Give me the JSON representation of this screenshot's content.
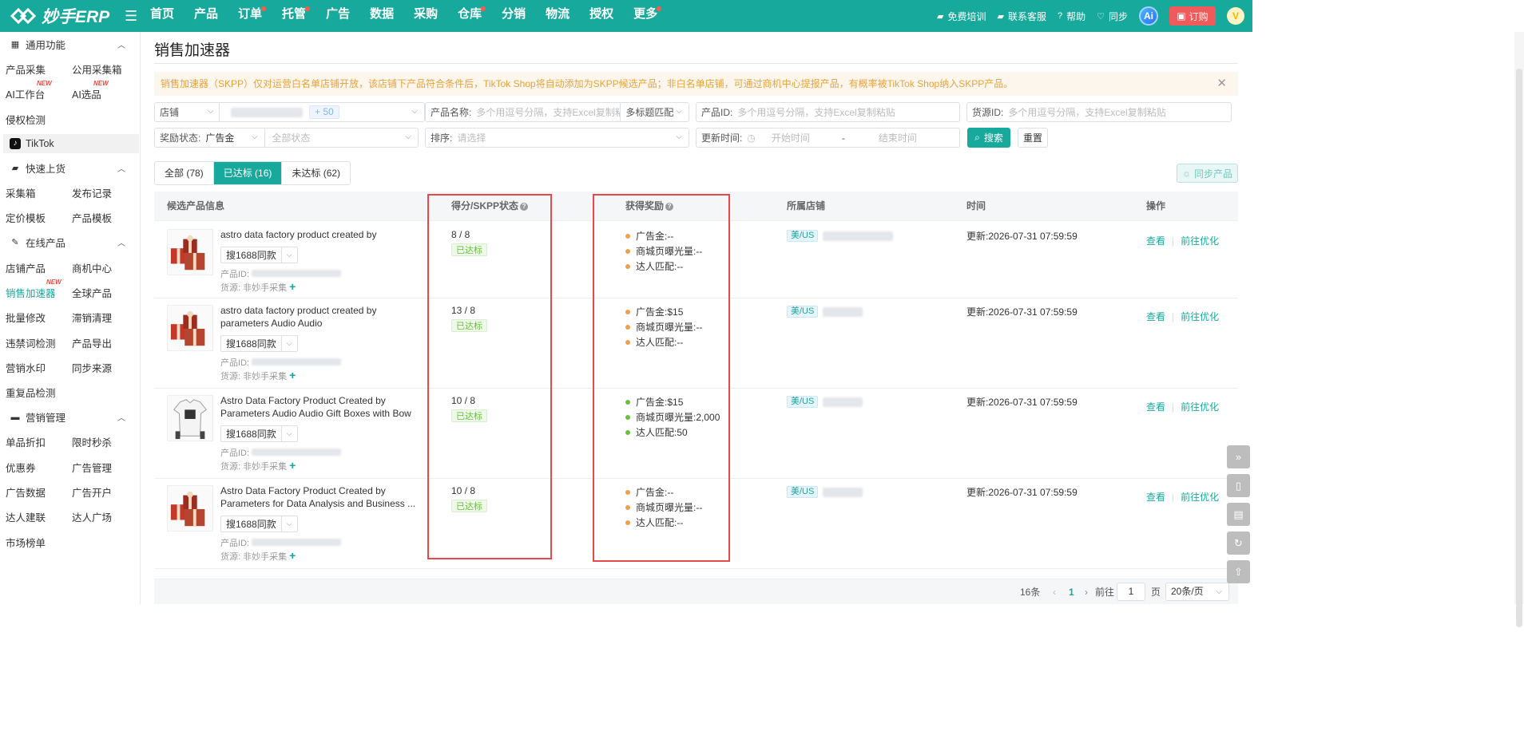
{
  "brand": {
    "name": "妙手ERP"
  },
  "nav": [
    {
      "label": "首页",
      "dot": false
    },
    {
      "label": "产品",
      "dot": false
    },
    {
      "label": "订单",
      "dot": true
    },
    {
      "label": "托管",
      "dot": true
    },
    {
      "label": "广告",
      "dot": false
    },
    {
      "label": "数据",
      "dot": false
    },
    {
      "label": "采购",
      "dot": false
    },
    {
      "label": "仓库",
      "dot": true
    },
    {
      "label": "分销",
      "dot": false
    },
    {
      "label": "物流",
      "dot": false
    },
    {
      "label": "授权",
      "dot": false
    },
    {
      "label": "更多",
      "dot": true
    }
  ],
  "topright": {
    "training": "免费培训",
    "service": "联系客服",
    "help": "帮助",
    "sync": "同步",
    "ai": "Ai",
    "order": "订购",
    "avatar": "V"
  },
  "sidebar": {
    "g1": "通用功能",
    "r1": [
      "产品采集",
      "公用采集箱"
    ],
    "r2": [
      "AI工作台",
      "AI选品"
    ],
    "r3": [
      "侵权检测"
    ],
    "tiktok": "TikTok",
    "g2": "快速上货",
    "r4": [
      "采集箱",
      "发布记录"
    ],
    "r5": [
      "定价模板",
      "产品模板"
    ],
    "g3": "在线产品",
    "r6": [
      "店铺产品",
      "商机中心"
    ],
    "r7": [
      "销售加速器",
      "全球产品"
    ],
    "r8": [
      "批量修改",
      "滞销清理"
    ],
    "r9": [
      "违禁词检测",
      "产品导出"
    ],
    "r10": [
      "营销水印",
      "同步来源"
    ],
    "r11": [
      "重复品检测"
    ],
    "g4": "营销管理",
    "r12": [
      "单品折扣",
      "限时秒杀"
    ],
    "r13": [
      "优惠券",
      "广告管理"
    ],
    "r14": [
      "广告数据",
      "广告开户"
    ],
    "r15": [
      "达人建联",
      "达人广场"
    ],
    "r16": [
      "市场榜单"
    ],
    "new": "NEW"
  },
  "page": {
    "title": "销售加速器",
    "alert": "销售加速器（SKPP）仅对运营白名单店铺开放，该店铺下产品符合条件后，TikTok Shop将自动添加为SKPP候选产品；非白名单店铺，可通过商机中心提报产品，有概率被TikTok Shop纳入SKPP产品。"
  },
  "filters": {
    "shop_label": "店铺",
    "shop_count": "+ 50",
    "pname_label": "产品名称:",
    "pname_ph": "多个用逗号分隔，支持Excel复制粘贴",
    "match": "多标题匹配",
    "pid_label": "产品ID:",
    "pid_ph": "多个用逗号分隔，支持Excel复制粘贴",
    "src_label": "货源ID:",
    "src_ph": "多个用逗号分隔，支持Excel复制粘贴",
    "reward_label": "奖励状态:",
    "reward_val": "广告金",
    "status_ph": "全部状态",
    "sort_label": "排序:",
    "sort_ph": "请选择",
    "time_label": "更新时间:",
    "start_ph": "开始时间",
    "dash": "-",
    "end_ph": "结束时间",
    "search": "搜索",
    "reset": "重置"
  },
  "tabs": [
    "全部 (78)",
    "已达标 (16)",
    "未达标 (62)"
  ],
  "sync_products": "同步产品",
  "table": {
    "headers": [
      "候选产品信息",
      "得分/SKPP状态",
      "获得奖励",
      "所属店铺",
      "时间",
      "操作"
    ],
    "btn1688": "搜1688同款",
    "pid_prefix": "产品ID:",
    "source_prefix": "货源:",
    "source_val": "非妙手采集",
    "reward_labels": [
      "广告金:",
      "商城页曝光量:",
      "达人匹配:"
    ],
    "time_prefix": "更新:",
    "op_view": "查看",
    "op_opt": "前往优化",
    "rows": [
      {
        "name": "astro data factory product created by parameters",
        "score": "8 / 8",
        "status": "已达标",
        "rewards": [
          "--",
          "--",
          "--"
        ],
        "dot": "#f0a04b",
        "region": "美/US",
        "time": "2026-07-31 07:59:59",
        "img": "gift"
      },
      {
        "name": "astro data factory product created by parameters Audio Audio {{seo_available_words}} ...",
        "score": "13 / 8",
        "status": "已达标",
        "rewards": [
          "$15",
          "--",
          "--"
        ],
        "dot": "#f0a04b",
        "region": "美/US",
        "time": "2026-07-31 07:59:59",
        "img": "gift"
      },
      {
        "name": "Astro Data Factory Product Created by Parameters Audio Audio Gift Boxes with Bow an...",
        "score": "10 / 8",
        "status": "已达标",
        "rewards": [
          "$15",
          "2,000",
          "50"
        ],
        "dot": "#67c23a",
        "region": "美/US",
        "time": "2026-07-31 07:59:59",
        "img": "shirt"
      },
      {
        "name": "Astro Data Factory Product Created by Parameters for Data Analysis and Business ...",
        "score": "10 / 8",
        "status": "已达标",
        "rewards": [
          "--",
          "--",
          "--"
        ],
        "dot": "#f0a04b",
        "region": "美/US",
        "time": "2026-07-31 07:59:59",
        "img": "gift"
      }
    ]
  },
  "pager": {
    "total": "16条",
    "current": "1",
    "goto": "前往",
    "page_val": "1",
    "page_unit": "页",
    "size": "20条/页"
  },
  "colors": {
    "brand": "#17a99c",
    "highlight_box": "#e74848"
  }
}
